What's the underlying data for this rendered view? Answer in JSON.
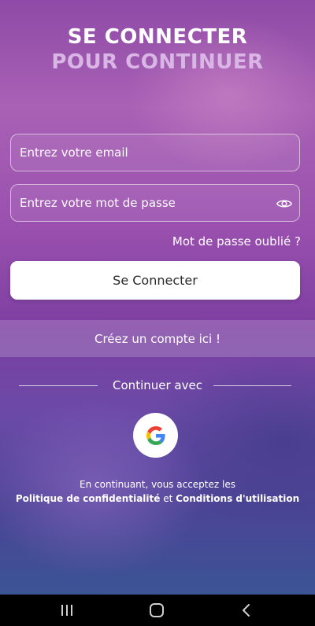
{
  "header": {
    "title_line1": "SE CONNECTER",
    "title_line2": "POUR CONTINUER"
  },
  "form": {
    "email_placeholder": "Entrez votre email",
    "email_value": "",
    "password_placeholder": "Entrez votre mot de passe",
    "password_value": "",
    "forgot_label": "Mot de passe oublié ?",
    "login_label": "Se Connecter"
  },
  "signup": {
    "label": "Créez un compte ici !"
  },
  "social": {
    "divider_label": "Continuer avec",
    "google_icon": "google-g-logo"
  },
  "legal": {
    "line1": "En continuant, vous acceptez les",
    "privacy_label": "Politique de confidentialité",
    "conjunction": "et",
    "terms_label": "Conditions d'utilisation"
  },
  "system_nav": {
    "recents_icon": "recents-icon",
    "home_icon": "home-icon",
    "back_icon": "back-icon"
  },
  "colors": {
    "background_top": "#8e4aa6",
    "background_bottom": "#3b5495",
    "title_secondary": "#d9b6e6",
    "button_bg": "#ffffff"
  }
}
